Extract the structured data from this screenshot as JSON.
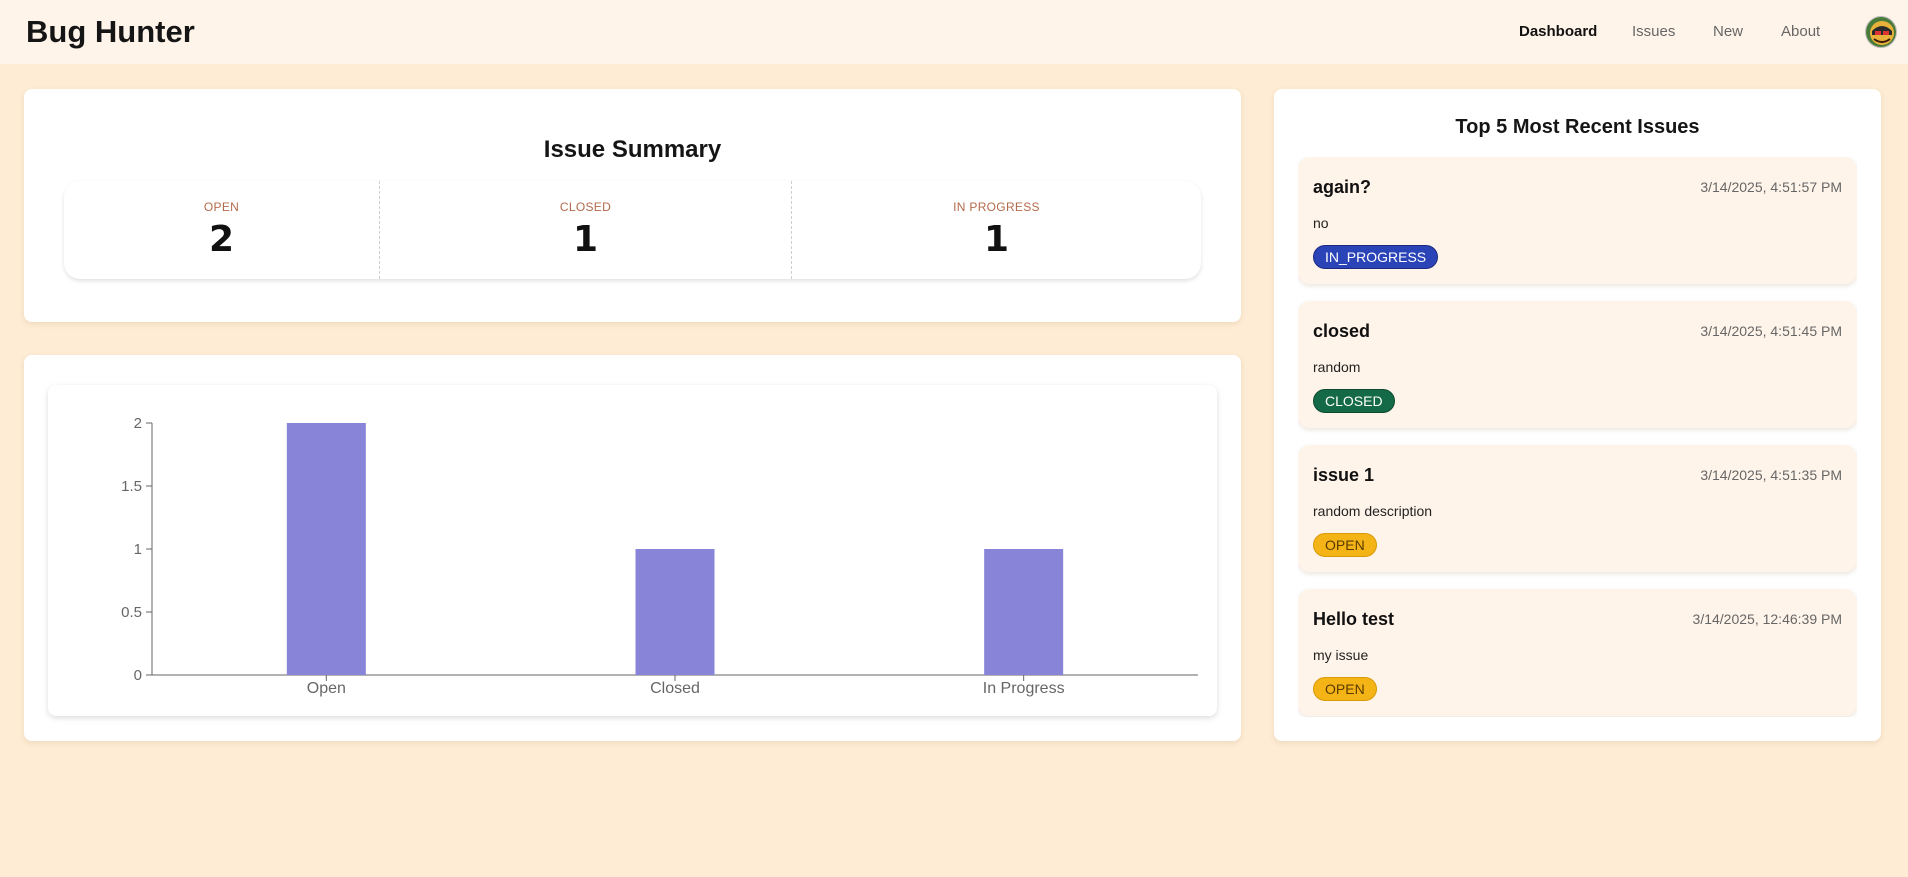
{
  "app": {
    "title": "Bug Hunter"
  },
  "nav": {
    "items": [
      {
        "label": "Dashboard",
        "active": true
      },
      {
        "label": "Issues",
        "active": false
      },
      {
        "label": "New",
        "active": false
      },
      {
        "label": "About",
        "active": false
      }
    ]
  },
  "summary": {
    "title": "Issue Summary",
    "stats": [
      {
        "label": "OPEN",
        "value": "2"
      },
      {
        "label": "CLOSED",
        "value": "1"
      },
      {
        "label": "IN PROGRESS",
        "value": "1"
      }
    ]
  },
  "chart_data": {
    "type": "bar",
    "categories": [
      "Open",
      "Closed",
      "In Progress"
    ],
    "values": [
      2,
      1,
      1
    ],
    "ylim": [
      0,
      2
    ],
    "yticks": [
      "0",
      "0.5",
      "1",
      "1.5",
      "2"
    ],
    "bar_color": "#8884d8",
    "grid": false,
    "legend": "none"
  },
  "recent": {
    "title": "Top 5 Most Recent Issues",
    "issues": [
      {
        "title": "again?",
        "date": "3/14/2025, 4:51:57 PM",
        "description": "no",
        "status": "IN_PROGRESS"
      },
      {
        "title": "closed",
        "date": "3/14/2025, 4:51:45 PM",
        "description": "random",
        "status": "CLOSED"
      },
      {
        "title": "issue 1",
        "date": "3/14/2025, 4:51:35 PM",
        "description": "random description",
        "status": "OPEN"
      },
      {
        "title": "Hello test",
        "date": "3/14/2025, 12:46:39 PM",
        "description": "my issue",
        "status": "OPEN"
      }
    ]
  },
  "colors": {
    "background": "#feecd4",
    "header": "#fff4ea",
    "status_in_progress": "#2a44b8",
    "status_closed": "#146a47",
    "status_open": "#f5b416"
  }
}
